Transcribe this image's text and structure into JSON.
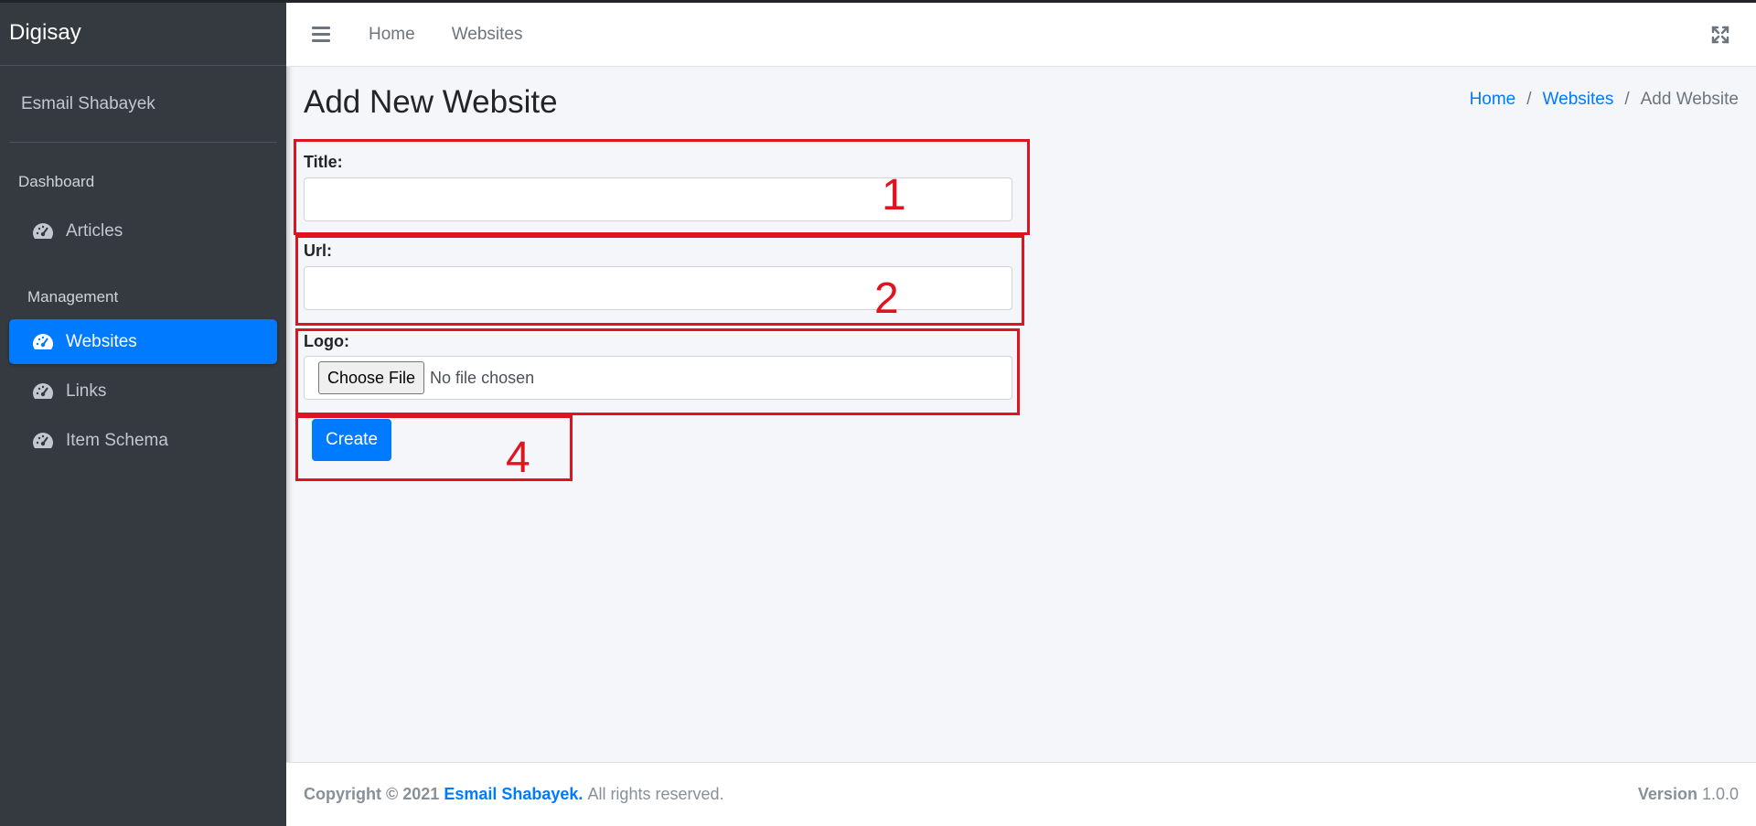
{
  "brand": "Digisay",
  "user": {
    "name": "Esmail Shabayek"
  },
  "sidebar": {
    "sections": [
      {
        "header": "Dashboard",
        "items": [
          {
            "label": "Articles",
            "icon": "tachometer-icon",
            "active": false
          }
        ]
      },
      {
        "header": "Management",
        "items": [
          {
            "label": "Websites",
            "icon": "tachometer-icon",
            "active": true
          },
          {
            "label": "Links",
            "icon": "tachometer-icon",
            "active": false
          },
          {
            "label": "Item Schema",
            "icon": "tachometer-icon",
            "active": false
          }
        ]
      }
    ]
  },
  "navbar": {
    "menu_icon": "bars-icon",
    "links": [
      "Home",
      "Websites"
    ],
    "fullscreen_icon": "expand-icon"
  },
  "page": {
    "title": "Add New Website",
    "breadcrumb": {
      "home": "Home",
      "websites": "Websites",
      "current": "Add Website",
      "separator": "/"
    }
  },
  "form": {
    "title_label": "Title:",
    "title_value": "",
    "url_label": "Url:",
    "url_value": "",
    "logo_label": "Logo:",
    "file_button": "Choose File",
    "file_status": "No file chosen",
    "submit_label": "Create"
  },
  "annotations": {
    "n1": "1",
    "n2": "2",
    "n4": "4",
    "color": "#e0141e"
  },
  "footer": {
    "copyright_prefix": "Copyright © 2021",
    "owner": "Esmail Shabayek.",
    "rights": "All rights reserved.",
    "version_label": "Version",
    "version_value": "1.0.0"
  },
  "colors": {
    "sidebar_bg": "#343a40",
    "accent": "#007bff",
    "content_bg": "#f4f6f9"
  }
}
